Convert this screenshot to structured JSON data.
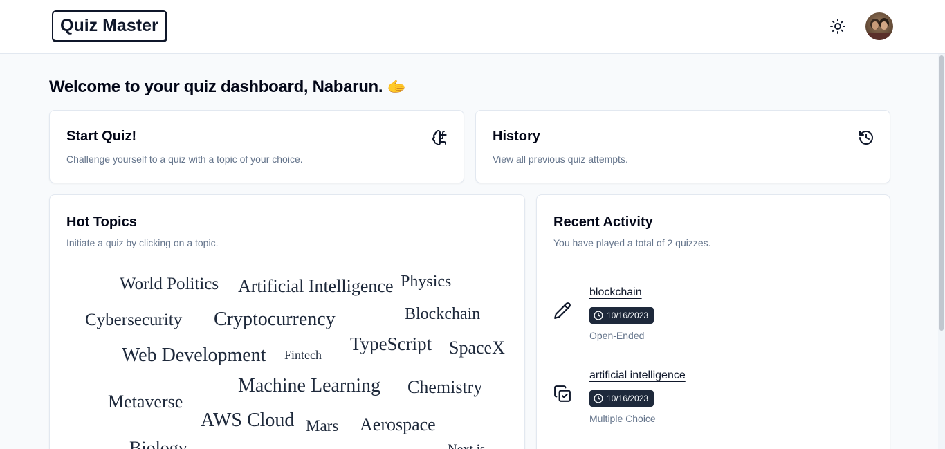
{
  "header": {
    "logo_text": "Quiz Master",
    "theme_icon": "sun-icon",
    "avatar_icon": "user-avatar"
  },
  "welcome": {
    "text": "Welcome to your quiz dashboard, Nabarun.",
    "emoji": "🫱"
  },
  "start_quiz": {
    "title": "Start Quiz!",
    "description": "Challenge yourself to a quiz with a topic of your choice.",
    "icon": "brain-icon"
  },
  "history": {
    "title": "History",
    "description": "View all previous quiz attempts.",
    "icon": "history-icon"
  },
  "hot_topics": {
    "title": "Hot Topics",
    "description": "Initiate a quiz by clicking on a topic.",
    "topics": [
      "World Politics",
      "Artificial Intelligence",
      "Physics",
      "Cybersecurity",
      "Cryptocurrency",
      "Blockchain",
      "Web Development",
      "Fintech",
      "TypeScript",
      "SpaceX",
      "Metaverse",
      "Machine Learning",
      "Chemistry",
      "AWS Cloud",
      "Mars",
      "Aerospace",
      "Biology",
      "Next.js"
    ]
  },
  "recent_activity": {
    "title": "Recent Activity",
    "description": "You have played a total of 2 quizzes.",
    "items": [
      {
        "topic": "blockchain",
        "date": "10/16/2023",
        "type": "Open-Ended",
        "icon": "pencil-icon"
      },
      {
        "topic": "artificial intelligence",
        "date": "10/16/2023",
        "type": "Multiple Choice",
        "icon": "copy-check-icon"
      }
    ]
  },
  "colors": {
    "page_bg": "#f8fafc",
    "badge_bg": "#1e293b",
    "muted_text": "#64748b"
  }
}
